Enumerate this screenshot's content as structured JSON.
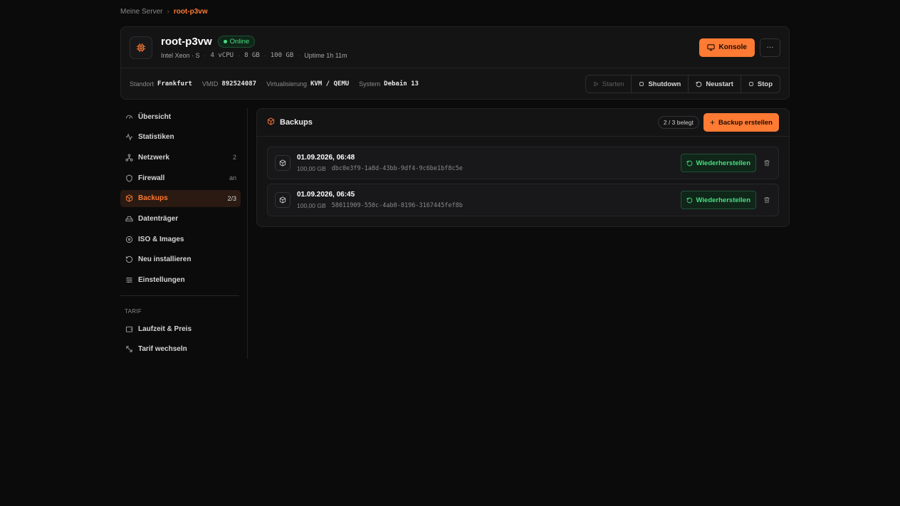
{
  "breadcrumb": {
    "parent": "Meine Server",
    "separator": "›",
    "current": "root-p3vw"
  },
  "server": {
    "name": "root-p3vw",
    "status": "Online",
    "meta": [
      "Intel Xeon · S",
      "4 vCPU",
      "8 GB",
      "100 GB",
      "Uptime 1h 11m"
    ],
    "konsole_label": "Konsole",
    "more_label": "···",
    "specs": [
      {
        "label": "Standort",
        "value": "Frankfurt"
      },
      {
        "label": "VMID",
        "value": "892524087"
      },
      {
        "label": "Virtualisierung",
        "value": "KVM / QEMU"
      },
      {
        "label": "System",
        "value": "Debain 13"
      }
    ],
    "power": [
      "Starten",
      "Shutdown",
      "Neustart",
      "Stop"
    ]
  },
  "sidebar": {
    "items": [
      {
        "label": "Übersicht",
        "badge": "",
        "icon": "gauge-icon"
      },
      {
        "label": "Statistiken",
        "badge": "",
        "icon": "activity-icon"
      },
      {
        "label": "Netzwerk",
        "badge": "2",
        "icon": "network-icon"
      },
      {
        "label": "Firewall",
        "badge": "an",
        "icon": "shield-icon"
      },
      {
        "label": "Backups",
        "badge": "2/3",
        "icon": "box-icon"
      },
      {
        "label": "Datenträger",
        "badge": "",
        "icon": "hard-drive-icon"
      },
      {
        "label": "ISO & Images",
        "badge": "",
        "icon": "disc-icon"
      },
      {
        "label": "Neu installieren",
        "badge": "",
        "icon": "rotate-icon"
      },
      {
        "label": "Einstellungen",
        "badge": "",
        "icon": "sliders-icon"
      }
    ],
    "tarif_header": "TARIF",
    "tarif_items": [
      {
        "label": "Laufzeit & Preis",
        "icon": "wallet-icon"
      },
      {
        "label": "Tarif wechseln",
        "icon": "arrows-icon"
      }
    ]
  },
  "backups": {
    "title": "Backups",
    "usage": "2 / 3 belegt",
    "create_label": "Backup erstellen",
    "restore_label": "Wiederherstellen",
    "rows": [
      {
        "date": "01.09.2026, 06:48",
        "size": "100,00 GB",
        "id": "dbc0e3f9-1a8d-43bb-9df4-9c6be1bf8c5e"
      },
      {
        "date": "01.09.2026, 06:45",
        "size": "100,00 GB",
        "id": "58011909-550c-4ab0-8196-3167445fef8b"
      }
    ]
  },
  "colors": {
    "accent": "#ff7a33",
    "success": "#4ade80",
    "background": "#0b0b0b",
    "panel": "#141415"
  }
}
